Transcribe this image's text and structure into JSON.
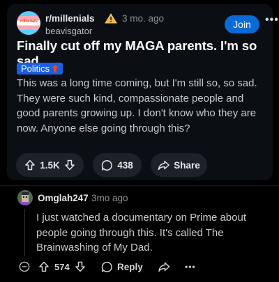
{
  "post": {
    "subreddit": "r/millenials",
    "subreddit_avatar_text": "millenials",
    "age": "3 mo. ago",
    "author": "beavisgator",
    "join_label": "Join",
    "more_label": "•••",
    "title": "Finally cut off my MAGA parents. I'm so sad",
    "flair": "Politics",
    "body": "This was a long time coming, but I'm still so, so sad. They were such kind, compassionate people and good parents growing up. I don't know who they are now. Anyone else going through this?",
    "votes": "1.5K",
    "comments": "438",
    "share_label": "Share"
  },
  "comment": {
    "author": "Omglah247",
    "age": "3mo ago",
    "body": "I just watched a documentary on Prime about people going through this. It's called The Brainwashing of My Dad.",
    "votes": "574",
    "reply_label": "Reply",
    "more_label": "•••"
  },
  "colors": {
    "join": "#0a6ad6",
    "flair": "#1a5fe0",
    "card_bg": "#0b0f14",
    "pill_bg": "#1c2228"
  },
  "icons": [
    "warning-icon",
    "upvote-icon",
    "downvote-icon",
    "comment-icon",
    "share-icon",
    "collapse-icon",
    "more-icon"
  ]
}
